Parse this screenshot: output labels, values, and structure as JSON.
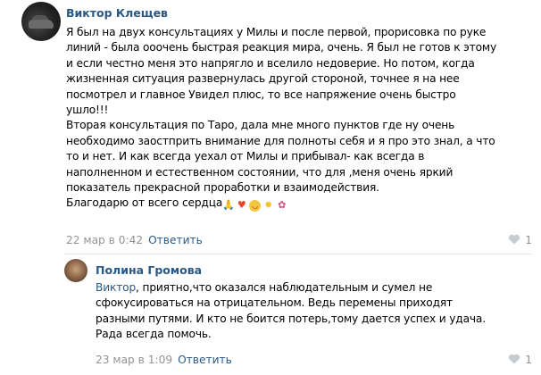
{
  "comments": [
    {
      "author": "Виктор Клещев",
      "lines": [
        "Я был на двух консультациях у Милы и после первой, прорисовка по руке",
        "линий - была ооочень быстрая реакция мира, очень. Я был не готов к этому",
        "и если честно меня это напрягло и вселило недоверие. Но потом, когда",
        "жизненная ситуация развернулась другой стороной, точнее я на нее",
        "посмотрел и главное Увидел плюс, то все напряжение очень быстро",
        "ушло!!!",
        "Вторая консультация по Таро, дала мне много пунктов где ну очень",
        "необходимо заостприть внимание для полноты себя и я про это знал, а что",
        "то и нет. И как всегда уехал от Милы и прибывал- как всегда в",
        "наполненном и естественном состоянии, что для ,меня очень яркий",
        "показатель прекрасной проработки и взаимодействия."
      ],
      "last_line": "Благодарю от всего сердца",
      "emojis": [
        "folded-hands",
        "heart",
        "smiling-face",
        "sun",
        "flower"
      ],
      "date": "22 мар в 0:42",
      "reply_label": "Ответить",
      "likes": "1"
    },
    {
      "author": "Полина Громова",
      "mention": "Виктор",
      "first_line_rest": ", приятно,что оказался наблюдательным и сумел не",
      "lines": [
        "сфокусироваться на отрицательном. Ведь перемены приходят",
        "разными путями. И кто не боится потерь,тому дается успех и удача.",
        "Рада всегда помочь."
      ],
      "date": "23 мар в 1:09",
      "reply_label": "Ответить",
      "likes": "1"
    }
  ],
  "colors": {
    "link": "#2a5885",
    "meta": "#939393",
    "divider": "#e7e8ec"
  }
}
